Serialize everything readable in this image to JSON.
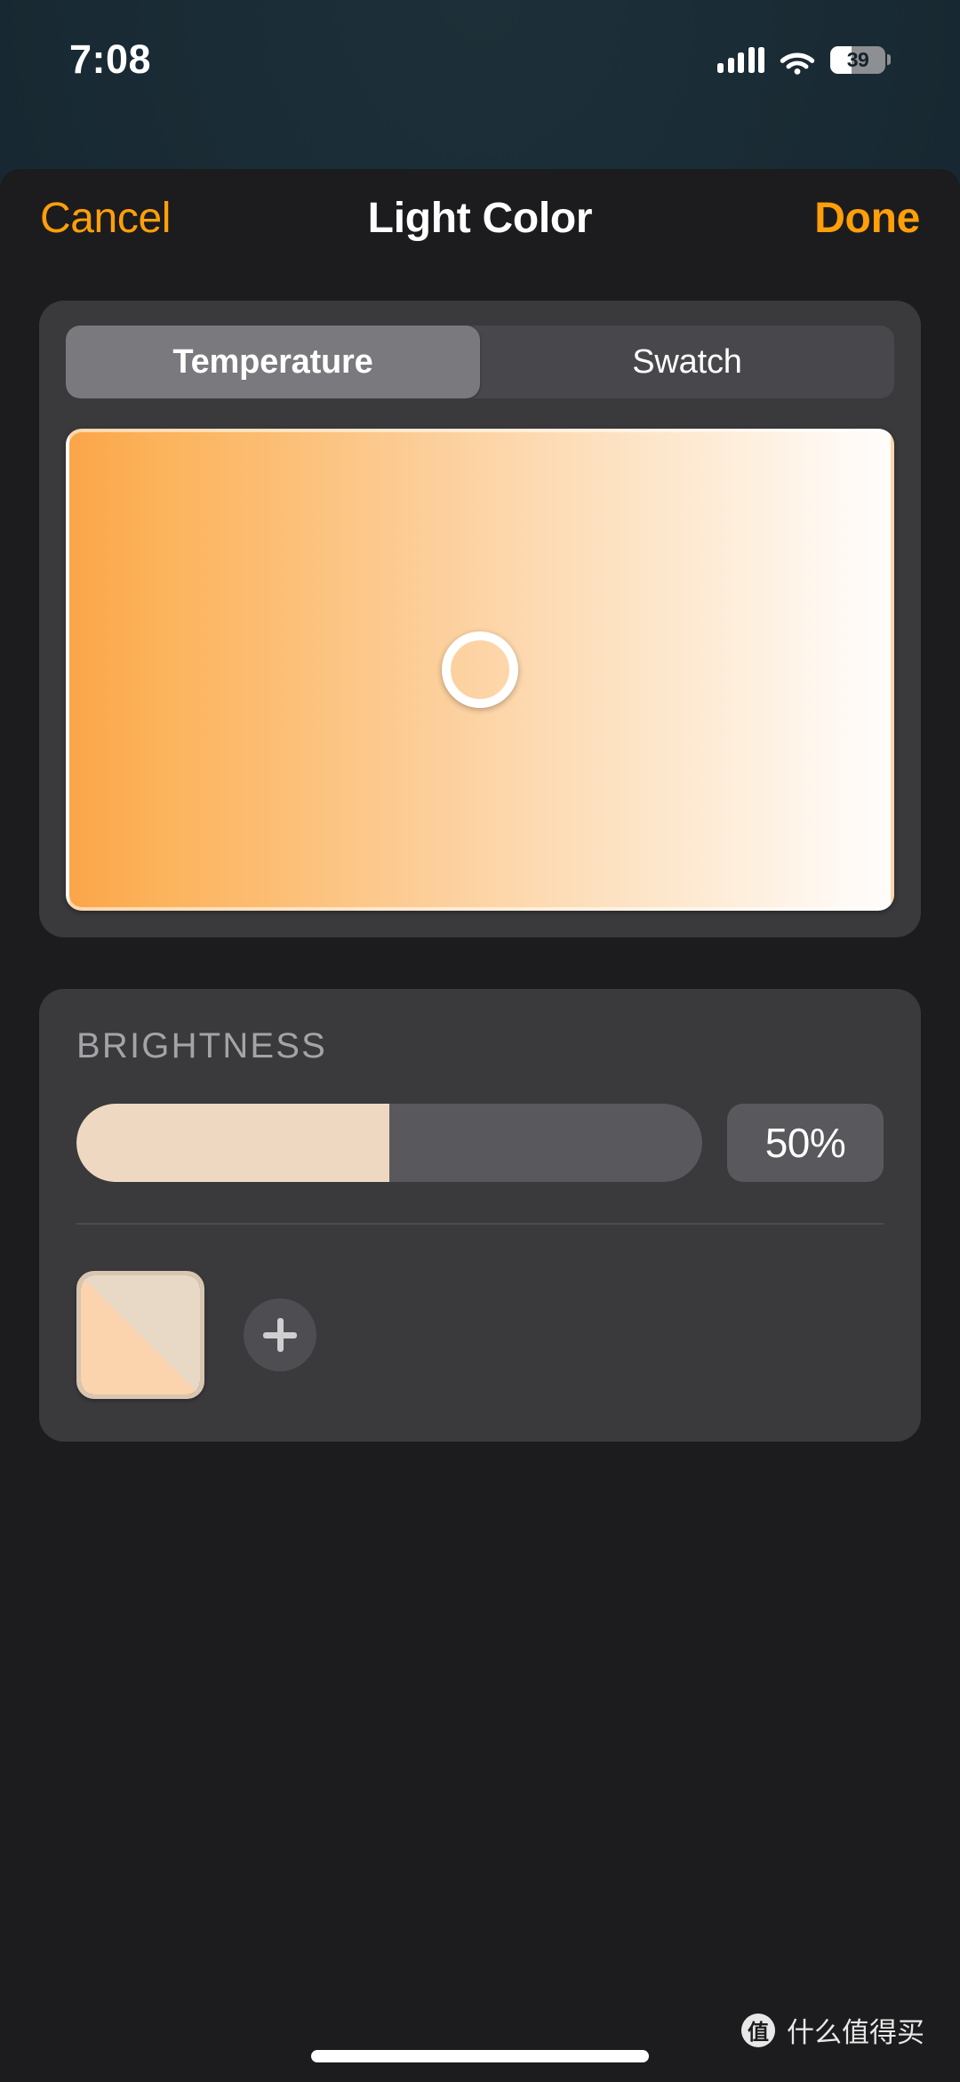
{
  "status_bar": {
    "time": "7:08",
    "signal_icon": "cellular-signal-icon",
    "wifi_icon": "wifi-icon",
    "battery_level": "39",
    "battery_percent_value": 39
  },
  "nav": {
    "cancel_label": "Cancel",
    "title": "Light Color",
    "done_label": "Done",
    "accent_color": "#FF9F0A"
  },
  "color_card": {
    "segments": [
      {
        "label": "Temperature",
        "selected": true
      },
      {
        "label": "Swatch",
        "selected": false
      }
    ],
    "temperature_picker": {
      "gradient_from": "#FBA54A",
      "gradient_to": "#FFFCFA",
      "handle_position_percent": 50,
      "handle_icon": "color-picker-handle-icon"
    }
  },
  "brightness_card": {
    "section_label": "BRIGHTNESS",
    "slider_value_percent": 50,
    "value_readout": "50%",
    "slider_fill_color": "#EED8C1",
    "slider_track_color": "#59595D",
    "swatches": [
      {
        "name": "saved-color-swatch",
        "top_color": "#FBD3AC",
        "bottom_color": "#E8D8C6",
        "selected": true
      }
    ],
    "add_swatch_icon": "plus-icon",
    "add_swatch_label": "+"
  },
  "footer": {
    "watermark_logo_text": "值",
    "watermark_text": "什么值得买",
    "home_indicator": "home-indicator"
  }
}
